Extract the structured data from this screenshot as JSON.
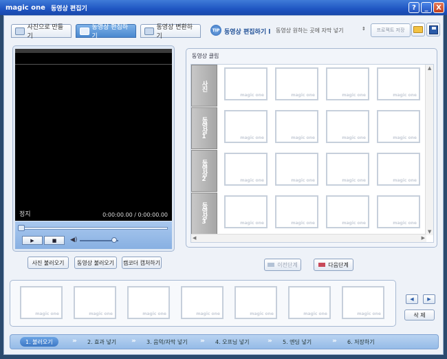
{
  "window": {
    "brand": "magic one",
    "title": "동영상 편집기",
    "buttons": [
      "?",
      "_",
      "X"
    ]
  },
  "toolbar": {
    "tabs": [
      {
        "label": "사진으로 만들기",
        "active": false
      },
      {
        "label": "동영상 편집하기",
        "active": true
      },
      {
        "label": "동영상 변환하기",
        "active": false
      }
    ],
    "step_badge": "TIP",
    "step_title": "동영상 편집하기 l",
    "step_desc": "동영상 원하는 곳에 자막 넣기",
    "project_save": "프로젝트 저장",
    "folder_icon": "folder-icon",
    "save_icon": "floppy-disk-icon"
  },
  "preview": {
    "state": "정지",
    "timecode": "0:00:00.00 / 0:00:00.00",
    "play_icon": "play-icon",
    "stop_icon": "stop-icon",
    "volume_icon": "speaker-icon",
    "buttons": {
      "load_photo": "사진 불러오기",
      "load_video": "동영상 불러오기",
      "camcorder_capture": "캠코더 캡처하기"
    }
  },
  "clips": {
    "label": "동영상 클립",
    "categories": [
      "사진",
      "동영상1",
      "동영상2",
      "동영상3"
    ],
    "watermark": "magic one",
    "thumb_count_per_row": 4
  },
  "navigation": {
    "prev": "이전단계",
    "next": "다음단계",
    "prev_enabled": false
  },
  "timeline": {
    "watermark": "magic one",
    "thumb_count": 7,
    "left_arrow": "◀",
    "right_arrow": "▶",
    "delete": "삭 제"
  },
  "steps": [
    {
      "label": "1. 불러오기",
      "active": true
    },
    {
      "label": "2. 효과 넣기",
      "active": false
    },
    {
      "label": "3. 음악/자막 넣기",
      "active": false
    },
    {
      "label": "4. 오프닝 넣기",
      "active": false
    },
    {
      "label": "5. 엔딩 넣기",
      "active": false
    },
    {
      "label": "6. 저장하기",
      "active": false
    }
  ]
}
